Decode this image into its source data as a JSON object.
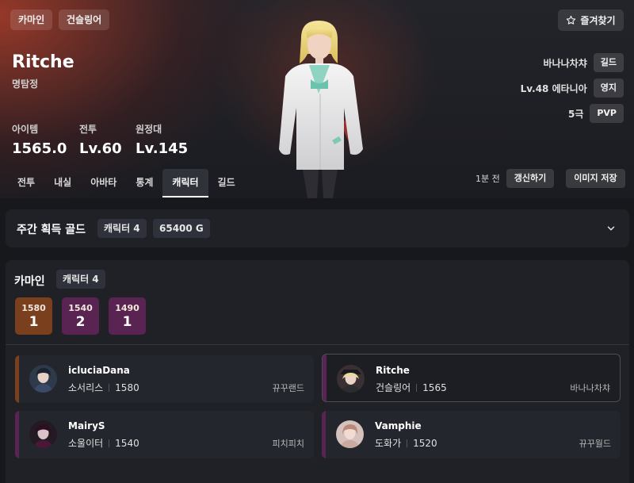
{
  "header": {
    "chips": [
      "카마인",
      "건슬링어"
    ],
    "name": "Ritche",
    "title": "명탐정",
    "favorite_label": "즐겨찾기",
    "stats": [
      {
        "label": "아이템",
        "value": "1565.0"
      },
      {
        "label": "전투",
        "value": "Lv.60"
      },
      {
        "label": "원정대",
        "value": "Lv.145"
      }
    ],
    "info": [
      {
        "text": "바나나차챠",
        "tag": "길드"
      },
      {
        "text": "Lv.48 에타니아",
        "tag": "영지"
      },
      {
        "text": "5극",
        "tag": "PVP"
      }
    ],
    "updated_ago": "1분 전",
    "refresh_label": "갱신하기",
    "save_image_label": "이미지 저장"
  },
  "tabs": [
    {
      "label": "전투",
      "active": false
    },
    {
      "label": "내실",
      "active": false
    },
    {
      "label": "아바타",
      "active": false
    },
    {
      "label": "통계",
      "active": false
    },
    {
      "label": "캐릭터",
      "active": true
    },
    {
      "label": "길드",
      "active": false
    }
  ],
  "weekly_gold": {
    "title": "주간 획득 골드",
    "character_count": "캐릭터 4",
    "gold": "65400 G"
  },
  "server_group": {
    "name": "카마인",
    "character_count": "캐릭터 4",
    "level_counts": [
      {
        "level": "1580",
        "count": "1",
        "color": "#7a3f1c"
      },
      {
        "level": "1540",
        "count": "2",
        "color": "#5a2452"
      },
      {
        "level": "1490",
        "count": "1",
        "color": "#5a2452"
      }
    ]
  },
  "characters": [
    {
      "name": "icluciaDana",
      "class": "소서리스",
      "level": "1580",
      "guild": "뀨꾸랜드",
      "accent": "#7a3f1c",
      "selected": false
    },
    {
      "name": "Ritche",
      "class": "건슬링어",
      "level": "1565",
      "guild": "바나나차챠",
      "accent": "#5a2452",
      "selected": true
    },
    {
      "name": "MairyS",
      "class": "소울이터",
      "level": "1540",
      "guild": "피치피치",
      "accent": "#5a2452",
      "selected": false
    },
    {
      "name": "Vamphie",
      "class": "도화가",
      "level": "1520",
      "guild": "뀨꾸월드",
      "accent": "#5a2452",
      "selected": false
    }
  ]
}
